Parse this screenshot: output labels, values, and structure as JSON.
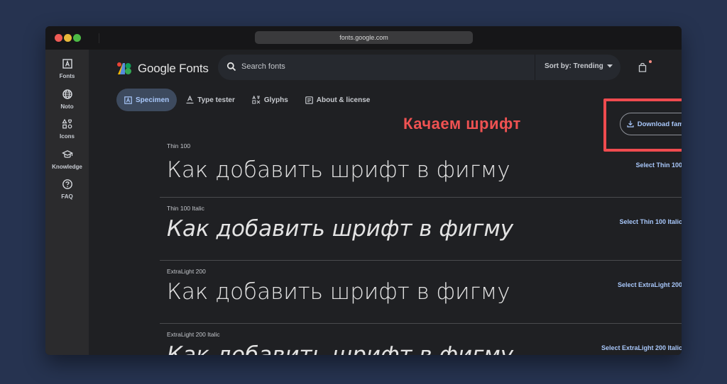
{
  "browser": {
    "url": "fonts.google.com",
    "traffic_lights": [
      "close",
      "minimize",
      "maximize"
    ]
  },
  "rail": {
    "items": [
      {
        "label": "Fonts",
        "icon": "font-box-icon"
      },
      {
        "label": "Noto",
        "icon": "globe-icon"
      },
      {
        "label": "Icons",
        "icon": "shapes-icon"
      },
      {
        "label": "Knowledge",
        "icon": "graduation-cap-icon"
      },
      {
        "label": "FAQ",
        "icon": "help-circle-icon"
      }
    ]
  },
  "header": {
    "logo_text": "Google Fonts",
    "search_placeholder": "Search fonts",
    "sort_label": "Sort by: Trending",
    "cart_icon": "shopping-bag-icon"
  },
  "tabs": [
    {
      "label": "Specimen",
      "active": true
    },
    {
      "label": "Type tester",
      "active": false
    },
    {
      "label": "Glyphs",
      "active": false
    },
    {
      "label": "About & license",
      "active": false
    }
  ],
  "annotation": {
    "text": "Качаем шрифт",
    "color": "#ef4b4f"
  },
  "download_button": "Download family",
  "styles": [
    {
      "label": "Thin 100",
      "sample": "Как добавить шрифт в фигму",
      "select": "Select Thin 100",
      "italic": false
    },
    {
      "label": "Thin 100 Italic",
      "sample": "Как добавить шрифт в фигму",
      "select": "Select Thin 100 Italic",
      "italic": true
    },
    {
      "label": "ExtraLight 200",
      "sample": "Как добавить шрифт в фигму",
      "select": "Select ExtraLight 200",
      "italic": false
    },
    {
      "label": "ExtraLight 200 Italic",
      "sample": "Как добавить шрифт в фигму",
      "select": "Select ExtraLight 200 Italic",
      "italic": true
    }
  ],
  "colors": {
    "accent": "#a8c7fa",
    "background": "#263350",
    "surface": "#1f2023"
  }
}
